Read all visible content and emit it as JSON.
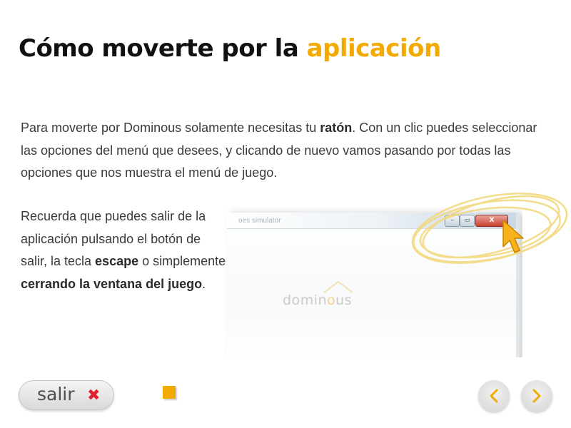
{
  "title": {
    "main": "Cómo moverte por la",
    "accent": "aplicación"
  },
  "intro": {
    "part1": "Para moverte por Dominous solamente necesitas tu ",
    "bold1": "ratón",
    "part2": ". Con un clic puedes seleccionar las opciones del menú que desees, y clicando de nuevo vamos pasando por todas las opciones que nos muestra el menú de juego."
  },
  "exit_info": {
    "part1": "Recuerda que puedes salir de la aplicación pulsando el botón de salir, la tecla ",
    "bold1": "escape",
    "part2": " o simplemente ",
    "bold2": "cerrando la ventana del juego",
    "part3": "."
  },
  "screenshot": {
    "window_title": "oes simulator",
    "logo_prefix": "domin",
    "logo_accent": "o",
    "logo_suffix": "us",
    "min_glyph": "–",
    "max_glyph": "▭",
    "close_glyph": "X"
  },
  "footer": {
    "exit_label": "salir",
    "exit_icon": "✖"
  },
  "colors": {
    "accent": "#f2a900",
    "exit_red": "#e0202c",
    "text": "#3a3a3a"
  },
  "icons": {
    "exit": "close-x-icon",
    "prev": "chevron-left-icon",
    "next": "chevron-right-icon",
    "cursor": "mouse-pointer-icon"
  }
}
